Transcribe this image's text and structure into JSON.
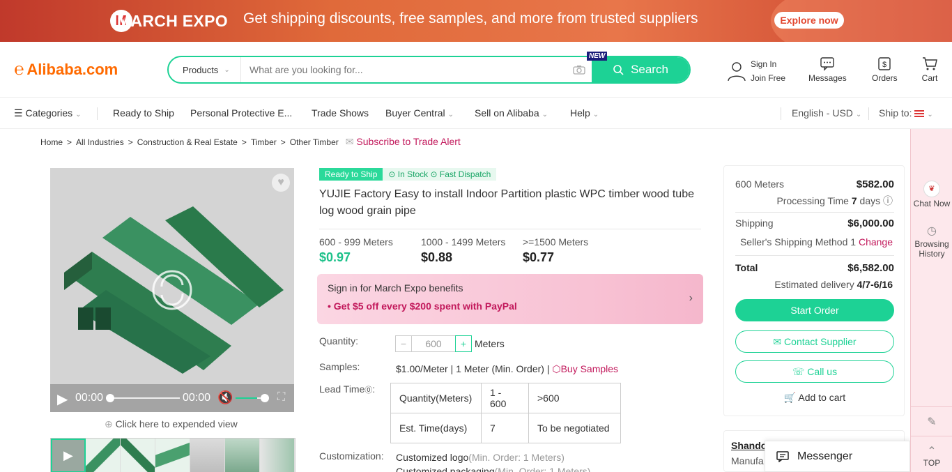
{
  "banner": {
    "brand": "MARCH EXPO",
    "text": "Get shipping discounts, free samples, and more from trusted suppliers",
    "cta": "Explore now"
  },
  "header": {
    "logo": "Alibaba.com",
    "search": {
      "category": "Products",
      "placeholder": "What are you looking for...",
      "button": "Search",
      "new_badge": "NEW"
    },
    "sign_in": "Sign In",
    "join": "Join Free",
    "messages": "Messages",
    "orders": "Orders",
    "cart": "Cart"
  },
  "nav": {
    "categories": "Categories",
    "items": [
      "Ready to Ship",
      "Personal Protective E...",
      "Trade Shows",
      "Buyer Central",
      "Sell on Alibaba",
      "Help"
    ],
    "language": "English - USD",
    "ship_to": "Ship to:"
  },
  "breadcrumb": {
    "items": [
      "Home",
      "All Industries",
      "Construction & Real Estate",
      "Timber",
      "Other Timber"
    ],
    "sep": ">",
    "subscribe": "Subscribe to Trade Alert"
  },
  "media": {
    "time_start": "00:00",
    "time_end": "00:00",
    "expand": "Click here to expended view",
    "volume_level": 0.7
  },
  "product": {
    "badge_rts": "Ready to Ship",
    "badge_stock": "In Stock",
    "badge_dispatch": "Fast Dispatch",
    "title": "YUJIE Factory Easy to install Indoor Partition plastic WPC timber wood tube log wood grain pipe",
    "tiers": [
      {
        "range": "600 - 999 Meters",
        "price": "$0.97"
      },
      {
        "range": "1000 - 1499 Meters",
        "price": "$0.88"
      },
      {
        "range": ">=1500 Meters",
        "price": "$0.77"
      }
    ],
    "promo_title": "Sign in for March Expo benefits",
    "promo_line": "• Get $5 off every $200 spent with PayPal",
    "quantity_label": "Quantity:",
    "quantity_value": "600",
    "quantity_unit": "Meters",
    "samples_label": "Samples:",
    "samples_text": "$1.00/Meter | 1 Meter (Min. Order) |",
    "buy_samples": "Buy Samples",
    "lead_label": "Lead Time",
    "lead_table": [
      [
        "Quantity(Meters)",
        "1 - 600",
        ">600"
      ],
      [
        "Est. Time(days)",
        "7",
        "To be negotiated"
      ]
    ],
    "custom_label": "Customization:",
    "custom_logo": "Customized logo",
    "custom_logo_mo": "(Min. Order: 1 Meters)",
    "custom_pack": "Customized packaging",
    "custom_pack_mo": "(Min. Order: 1 Meters)"
  },
  "order": {
    "qty": "600 Meters",
    "subtotal": "$582.00",
    "processing_label": "Processing Time",
    "processing_days": "7",
    "processing_unit": "days",
    "shipping_label": "Shipping",
    "shipping": "$6,000.00",
    "method": "Seller's Shipping Method 1",
    "change": "Change",
    "total_label": "Total",
    "total": "$6,582.00",
    "delivery_label": "Estimated delivery",
    "delivery": "4/7-6/16",
    "start": "Start Order",
    "contact": "Contact Supplier",
    "call": "Call us",
    "add_cart": "Add to cart"
  },
  "supplier": {
    "name": "Shando",
    "type": "Manufa"
  },
  "sidebar": {
    "chat": "Chat Now",
    "history": "Browsing History",
    "top": "TOP"
  },
  "messenger": "Messenger",
  "colors": {
    "accent": "#1dd295",
    "brand": "#ff6a00",
    "promo": "#c2185b"
  }
}
